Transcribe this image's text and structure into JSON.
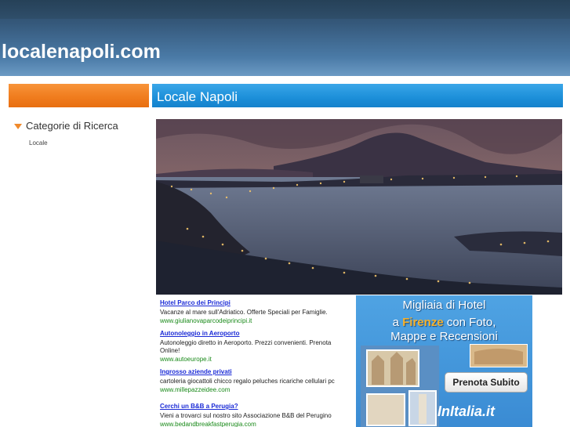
{
  "header": {
    "site_title": "localenapoli.com"
  },
  "main": {
    "title": "Locale Napoli"
  },
  "sidebar": {
    "heading": "Categorie di Ricerca",
    "items": [
      {
        "label": "Locale"
      }
    ]
  },
  "ads": [
    {
      "title": "Hotel Parco dei Principi",
      "desc": "Vacanze al mare sull'Adriatico. Offerte Speciali per Famiglie.",
      "url": "www.giulianovaparcodeiprincipi.it"
    },
    {
      "title": "Autonoleggio in Aeroporto",
      "desc": "Autonoleggio diretto in Aeroporto. Prezzi convenienti. Prenota Online!",
      "url": "www.autoeurope.it"
    },
    {
      "title": "Ingrosso aziende privati",
      "desc": "cartoleria giocattoli chicco regalo peluches ricariche cellulari pc",
      "url": "www.millepazzeidee.com"
    },
    {
      "title": "Cerchi un B&B a Perugia?",
      "desc": "Vieni a trovarci sul nostro sito Associazione B&B del Perugino",
      "url": "www.bedandbreakfastperugia.com"
    }
  ],
  "banner": {
    "line1": "Migliaia di Hotel",
    "line2_pre": "a ",
    "line2_city": "Firenze",
    "line2_post": " con Foto,",
    "line3": "Mappe e Recensioni",
    "cta": "Prenota Subito",
    "logo": "InItalia.it"
  },
  "colors": {
    "header": "#35587a",
    "orange_bar": "#f07d1e",
    "blue_bar": "#1c8fd9",
    "ad_link": "#1a2ad6",
    "ad_url": "#1a8a1a"
  }
}
